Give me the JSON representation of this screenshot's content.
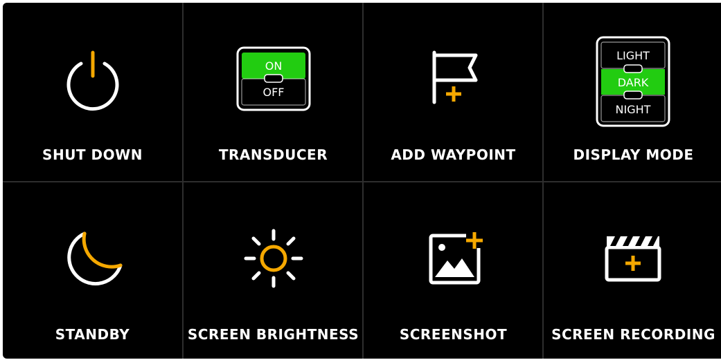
{
  "colors": {
    "background": "#000000",
    "divider": "#2e2e2e",
    "text": "#ffffff",
    "accent": "#f5a800",
    "active": "#22cc11"
  },
  "tiles": [
    {
      "label": "SHUT DOWN",
      "icon": "power-icon"
    },
    {
      "label": "TRANSDUCER",
      "icon": "toggle-switch-icon",
      "options": [
        "ON",
        "OFF"
      ],
      "selected": "ON"
    },
    {
      "label": "ADD WAYPOINT",
      "icon": "flag-plus-icon"
    },
    {
      "label": "DISPLAY MODE",
      "icon": "mode-selector-icon",
      "options": [
        "LIGHT",
        "DARK",
        "NIGHT"
      ],
      "selected": "DARK"
    },
    {
      "label": "STANDBY",
      "icon": "moon-icon"
    },
    {
      "label": "SCREEN BRIGHTNESS",
      "icon": "sun-icon"
    },
    {
      "label": "SCREENSHOT",
      "icon": "image-plus-icon"
    },
    {
      "label": "SCREEN RECORDING",
      "icon": "clapperboard-plus-icon"
    }
  ]
}
